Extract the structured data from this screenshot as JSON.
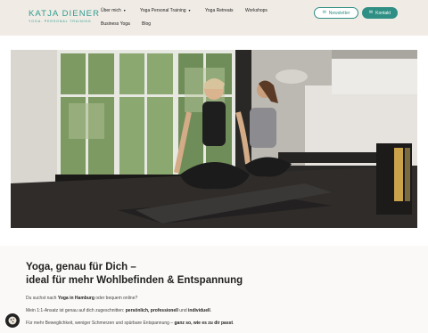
{
  "header": {
    "logo_name": "KATJA DIENER",
    "logo_sub": "YOGA. PERSONAL TRAINING",
    "nav": {
      "ueber_mich": "Über mich",
      "personal_training": "Yoga Personal Training",
      "retreats": "Yoga Retreats",
      "workshops": "Workshops",
      "business": "Business Yoga",
      "blog": "Blog"
    },
    "newsletter_label": "Newsletter",
    "kontakt_label": "Kontakt"
  },
  "colors": {
    "accent": "#2f8f84",
    "header_bg": "#f0ebe5"
  },
  "content": {
    "heading_line1": "Yoga, genau für Dich –",
    "heading_line2": "ideal für mehr Wohlbefinden & Entspannung",
    "p1_pre": "Du suchst nach ",
    "p1_bold": "Yoga in Hamburg",
    "p1_post": " oder bequem online?",
    "p2_pre": "Mein 1:1-Ansatz ist genau auf dich zugeschnitten: ",
    "p2_b1": "persönlich, professionell",
    "p2_mid": " und ",
    "p2_b2": "individuell",
    "p2_post": ".",
    "p3_pre": "Für mehr Beweglichkeit, weniger Schmerzen und spürbare Entspannung – ",
    "p3_bold": "ganz so, wie es zu dir passt",
    "p3_post": "."
  }
}
